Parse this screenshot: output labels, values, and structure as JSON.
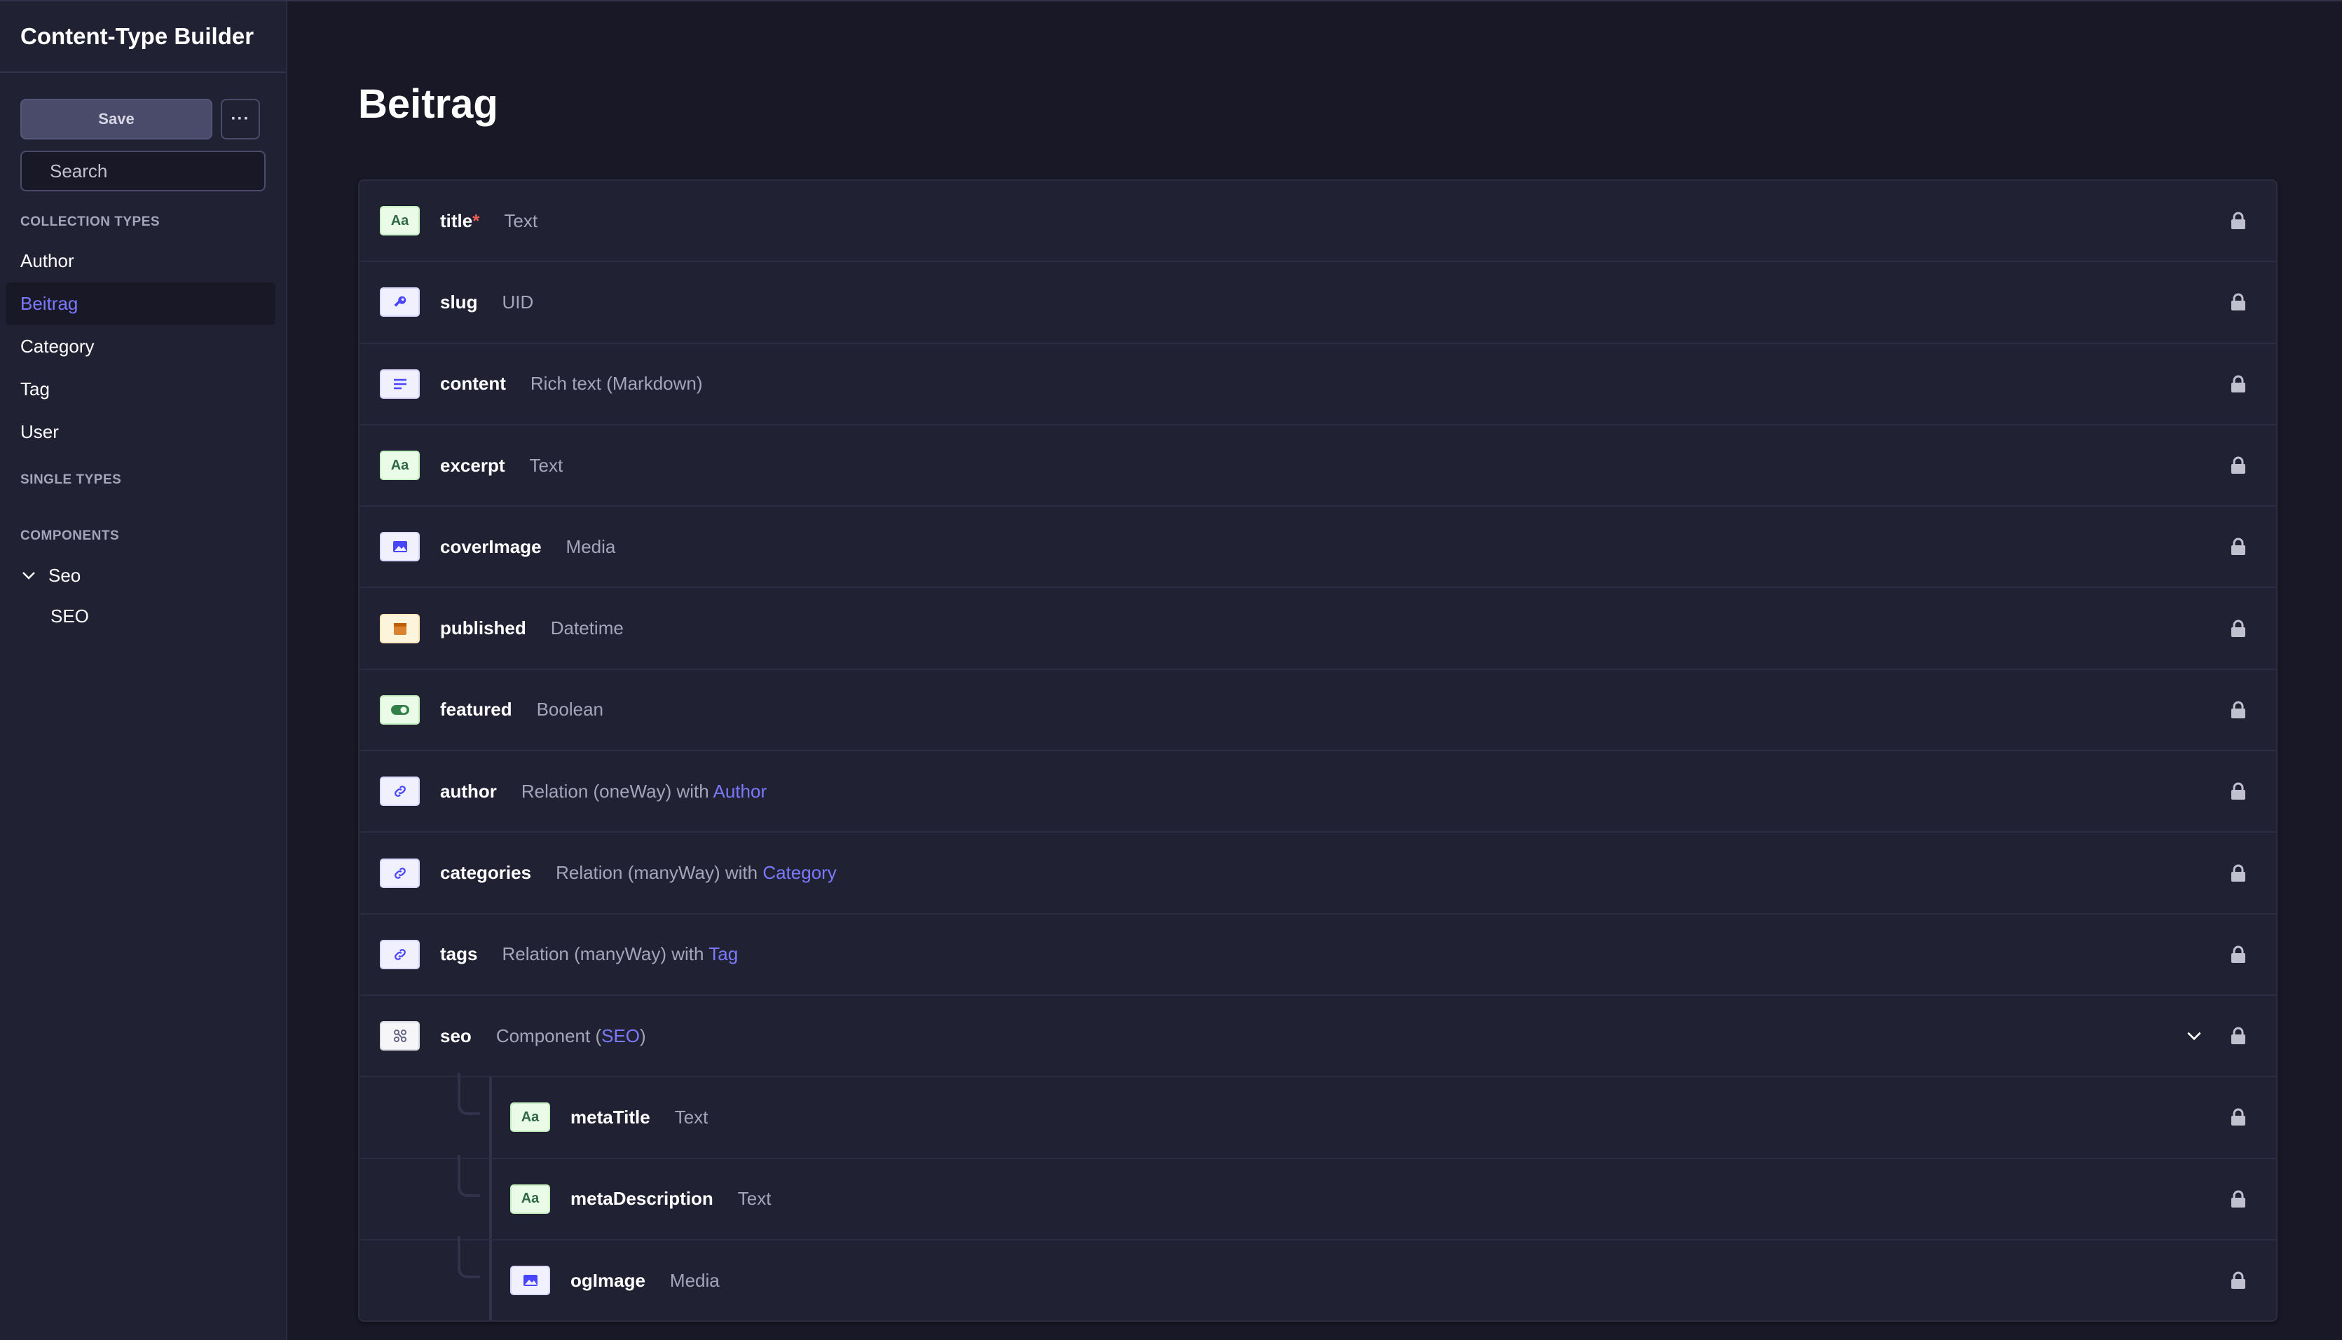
{
  "sidebar": {
    "title": "Content-Type Builder",
    "save_label": "Save",
    "more_label": "···",
    "search_placeholder": "Search",
    "sections": {
      "collection_types": "COLLECTION TYPES",
      "single_types": "SINGLE TYPES",
      "components": "COMPONENTS"
    },
    "collection_items": [
      "Author",
      "Beitrag",
      "Category",
      "Tag",
      "User"
    ],
    "active_item": "Beitrag",
    "component_group": "Seo",
    "component_items": [
      "SEO"
    ]
  },
  "main": {
    "title": "Beitrag",
    "fields": [
      {
        "name": "title",
        "required": "*",
        "type": "Text",
        "icon": "text-icon"
      },
      {
        "name": "slug",
        "type": "UID",
        "icon": "uid-icon"
      },
      {
        "name": "content",
        "type": "Rich text (Markdown)",
        "icon": "richtext-icon"
      },
      {
        "name": "excerpt",
        "type": "Text",
        "icon": "text-icon"
      },
      {
        "name": "coverImage",
        "type": "Media",
        "icon": "media-icon"
      },
      {
        "name": "published",
        "type": "Datetime",
        "icon": "date-icon"
      },
      {
        "name": "featured",
        "type": "Boolean",
        "icon": "boolean-icon"
      },
      {
        "name": "author",
        "type": "Relation (oneWay) with ",
        "target": "Author",
        "icon": "relation-icon"
      },
      {
        "name": "categories",
        "type": "Relation (manyWay) with ",
        "target": "Category",
        "icon": "relation-icon"
      },
      {
        "name": "tags",
        "type": "Relation (manyWay) with ",
        "target": "Tag",
        "icon": "relation-icon"
      },
      {
        "name": "seo",
        "type": "Component (",
        "target": "SEO",
        "type_suffix": ")",
        "icon": "component-icon"
      },
      {
        "name": "metaTitle",
        "type": "Text",
        "icon": "text-icon"
      },
      {
        "name": "metaDescription",
        "type": "Text",
        "icon": "text-icon"
      },
      {
        "name": "ogImage",
        "type": "Media",
        "icon": "media-icon"
      }
    ]
  },
  "colors": {
    "accent": "#7b79ff",
    "required": "#ee5e52",
    "background": "#181826",
    "panel": "#212134"
  }
}
